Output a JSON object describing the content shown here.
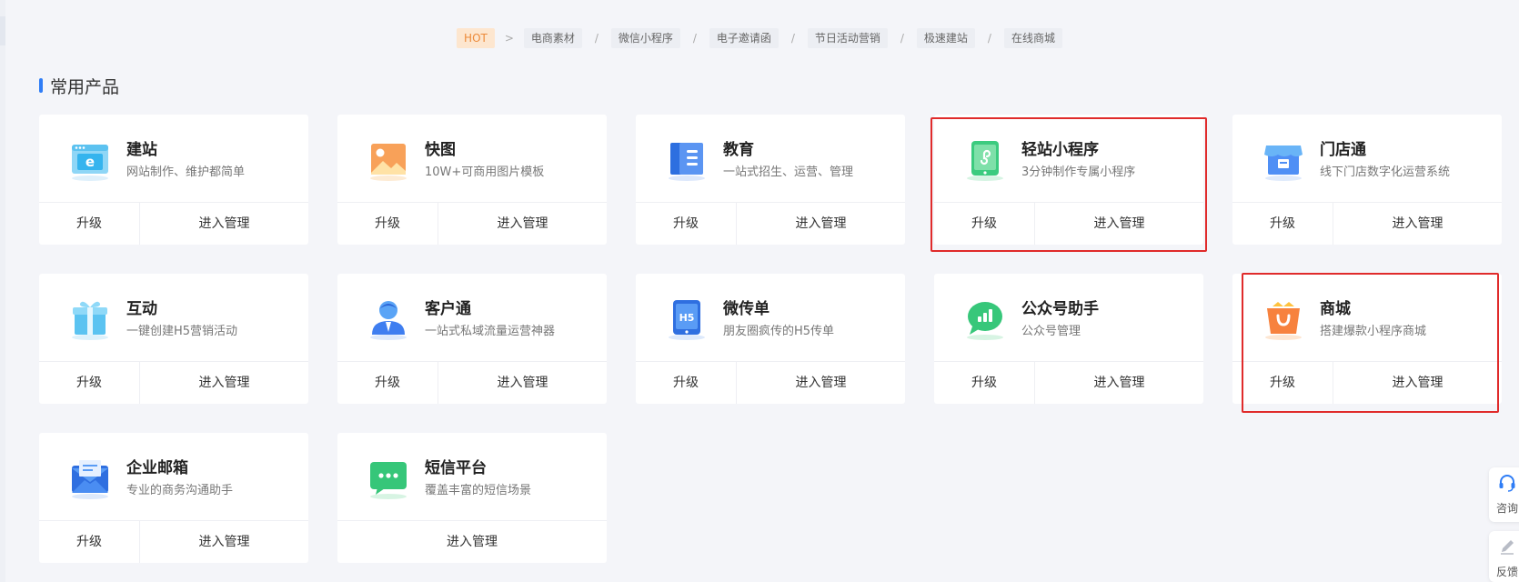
{
  "tags": [
    {
      "label": "HOT",
      "hot": true
    },
    {
      "label": "电商素材"
    },
    {
      "label": "微信小程序"
    },
    {
      "label": "电子邀请函"
    },
    {
      "label": "节日活动营销"
    },
    {
      "label": "极速建站"
    },
    {
      "label": "在线商城"
    }
  ],
  "tag_separators": [
    ">",
    "/",
    "/",
    "/",
    "/",
    "/"
  ],
  "section_title": "常用产品",
  "products": [
    {
      "name": "建站",
      "desc": "网站制作、维护都简单",
      "icon": "website-icon",
      "upgrade": "升级",
      "manage": "进入管理"
    },
    {
      "name": "快图",
      "desc": "10W+可商用图片模板",
      "icon": "picture-icon",
      "upgrade": "升级",
      "manage": "进入管理"
    },
    {
      "name": "教育",
      "desc": "一站式招生、运营、管理",
      "icon": "book-icon",
      "upgrade": "升级",
      "manage": "进入管理"
    },
    {
      "name": "轻站小程序",
      "desc": "3分钟制作专属小程序",
      "icon": "mini-program-icon",
      "upgrade": "升级",
      "manage": "进入管理",
      "highlighted": true
    },
    {
      "name": "门店通",
      "desc": "线下门店数字化运营系统",
      "icon": "store-icon",
      "upgrade": "升级",
      "manage": "进入管理"
    },
    {
      "name": "互动",
      "desc": "一键创建H5营销活动",
      "icon": "gift-icon",
      "upgrade": "升级",
      "manage": "进入管理"
    },
    {
      "name": "客户通",
      "desc": "一站式私域流量运营神器",
      "icon": "customer-icon",
      "upgrade": "升级",
      "manage": "进入管理"
    },
    {
      "name": "微传单",
      "desc": "朋友圈疯传的H5传单",
      "icon": "h5-phone-icon",
      "upgrade": "升级",
      "manage": "进入管理"
    },
    {
      "name": "公众号助手",
      "desc": "公众号管理",
      "icon": "chat-chart-icon",
      "upgrade": "升级",
      "manage": "进入管理"
    },
    {
      "name": "商城",
      "desc": "搭建爆款小程序商城",
      "icon": "shopping-bag-icon",
      "upgrade": "升级",
      "manage": "进入管理",
      "highlighted": true
    },
    {
      "name": "企业邮箱",
      "desc": "专业的商务沟通助手",
      "icon": "mail-icon",
      "upgrade": "升级",
      "manage": "进入管理"
    },
    {
      "name": "短信平台",
      "desc": "覆盖丰富的短信场景",
      "icon": "sms-icon",
      "manage": "进入管理"
    }
  ],
  "float": {
    "consult": "咨询",
    "feedback": "反馈"
  },
  "colors": {
    "accent": "#2f7df6",
    "highlight": "#e02b2b",
    "hot_bg": "#fde6cf",
    "hot_text": "#ec8a3a"
  }
}
